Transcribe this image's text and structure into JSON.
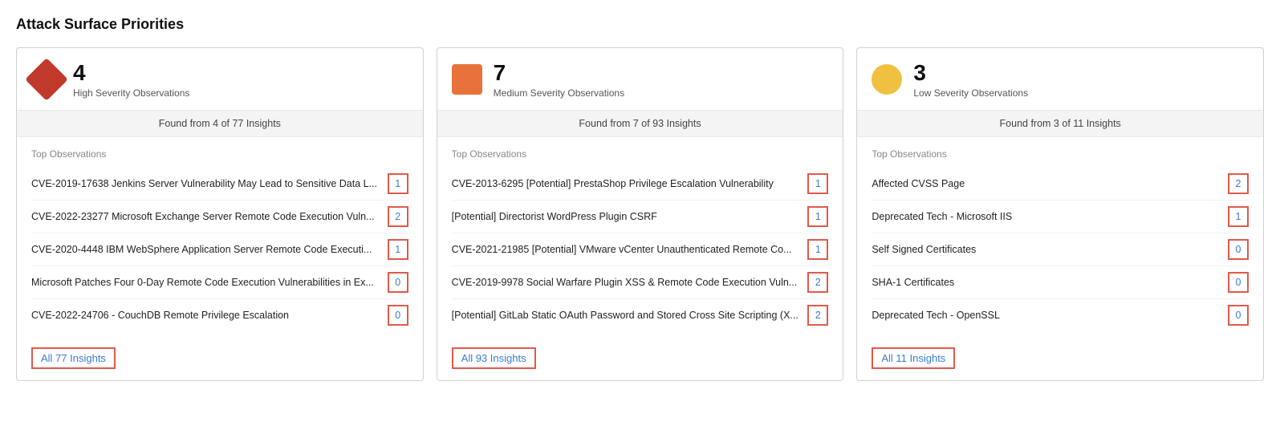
{
  "page": {
    "title": "Attack Surface Priorities"
  },
  "cards": [
    {
      "id": "high",
      "severity": "high",
      "count": "4",
      "label": "High Severity Observations",
      "found_text": "Found from 4 of 77 Insights",
      "section_label": "Top Observations",
      "observations": [
        {
          "name": "CVE-2019-17638 Jenkins Server Vulnerability May Lead to Sensitive Data L...",
          "count": "1"
        },
        {
          "name": "CVE-2022-23277 Microsoft Exchange Server Remote Code Execution Vuln...",
          "count": "2"
        },
        {
          "name": "CVE-2020-4448 IBM WebSphere Application Server Remote Code Executi...",
          "count": "1"
        },
        {
          "name": "Microsoft Patches Four 0-Day Remote Code Execution Vulnerabilities in Ex...",
          "count": "0"
        },
        {
          "name": "CVE-2022-24706 - CouchDB Remote Privilege Escalation",
          "count": "0"
        }
      ],
      "insights_link": "All 77 Insights"
    },
    {
      "id": "medium",
      "severity": "medium",
      "count": "7",
      "label": "Medium Severity Observations",
      "found_text": "Found from 7 of 93 Insights",
      "section_label": "Top Observations",
      "observations": [
        {
          "name": "CVE-2013-6295 [Potential] PrestaShop Privilege Escalation Vulnerability",
          "count": "1"
        },
        {
          "name": "[Potential] Directorist WordPress Plugin CSRF",
          "count": "1"
        },
        {
          "name": "CVE-2021-21985 [Potential] VMware vCenter Unauthenticated Remote Co...",
          "count": "1"
        },
        {
          "name": "CVE-2019-9978 Social Warfare Plugin XSS & Remote Code Execution Vuln...",
          "count": "2"
        },
        {
          "name": "[Potential] GitLab Static OAuth Password and Stored Cross Site Scripting (X...",
          "count": "2"
        }
      ],
      "insights_link": "All 93 Insights"
    },
    {
      "id": "low",
      "severity": "low",
      "count": "3",
      "label": "Low Severity Observations",
      "found_text": "Found from 3 of 11 Insights",
      "section_label": "Top Observations",
      "observations": [
        {
          "name": "Affected CVSS Page",
          "count": "2"
        },
        {
          "name": "Deprecated Tech - Microsoft IIS",
          "count": "1"
        },
        {
          "name": "Self Signed Certificates",
          "count": "0"
        },
        {
          "name": "SHA-1 Certificates",
          "count": "0"
        },
        {
          "name": "Deprecated Tech - OpenSSL",
          "count": "0"
        }
      ],
      "insights_link": "All 11 Insights"
    }
  ]
}
